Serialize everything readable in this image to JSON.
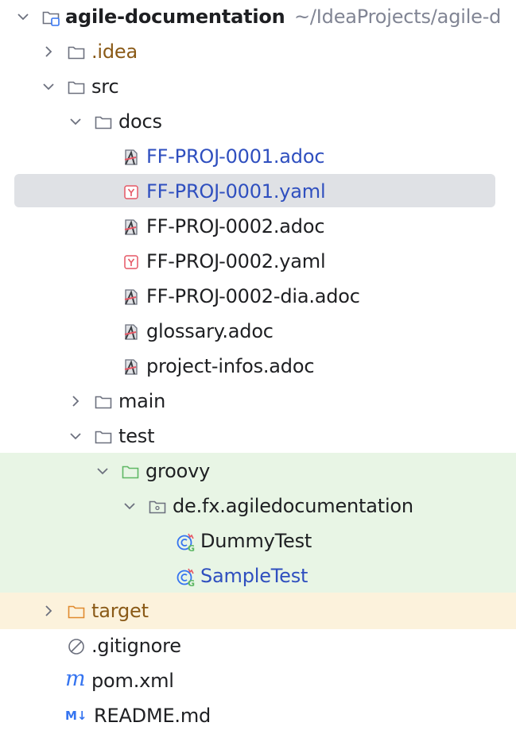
{
  "project_tree": {
    "root": {
      "label": "agile-documentation",
      "path": "~/IdeaProjects/agile-d"
    },
    "idea": {
      "label": ".idea"
    },
    "src": {
      "label": "src"
    },
    "docs": {
      "label": "docs"
    },
    "files": {
      "ff_proj_0001_adoc": {
        "label": "FF-PROJ-0001.adoc"
      },
      "ff_proj_0001_yaml": {
        "label": "FF-PROJ-0001.yaml"
      },
      "ff_proj_0002_adoc": {
        "label": "FF-PROJ-0002.adoc"
      },
      "ff_proj_0002_yaml": {
        "label": "FF-PROJ-0002.yaml"
      },
      "ff_proj_0002_dia_adoc": {
        "label": "FF-PROJ-0002-dia.adoc"
      },
      "glossary_adoc": {
        "label": "glossary.adoc"
      },
      "project_infos_adoc": {
        "label": "project-infos.adoc"
      }
    },
    "main": {
      "label": "main"
    },
    "test": {
      "label": "test"
    },
    "groovy": {
      "label": "groovy"
    },
    "package": {
      "label": "de.fx.agiledocumentation"
    },
    "dummy_test": {
      "label": "DummyTest"
    },
    "sample_test": {
      "label": "SampleTest"
    },
    "target": {
      "label": "target"
    },
    "gitignore": {
      "label": ".gitignore"
    },
    "pom": {
      "label": "pom.xml",
      "icon_text": "m"
    },
    "readme": {
      "label": "README.md",
      "icon_text": "M↓"
    }
  },
  "icons": {
    "root": "module-folder-icon",
    "folder": "folder-icon",
    "test_folder": "test-sources-folder-icon",
    "excluded_folder": "excluded-folder-icon",
    "package": "package-icon",
    "asciidoc": "asciidoc-file-icon",
    "yaml": "yaml-file-icon",
    "groovy_test": "groovy-test-class-icon",
    "ignore": "ignore-file-icon",
    "maven": "maven-pom-icon",
    "markdown": "markdown-file-icon"
  },
  "colors": {
    "selection": "#dfe1e5",
    "test_band": "#e8f5e5",
    "excluded_band": "#fcf2dc",
    "modified_text": "#2f4fbf",
    "ignored_text": "#8a5a17"
  }
}
